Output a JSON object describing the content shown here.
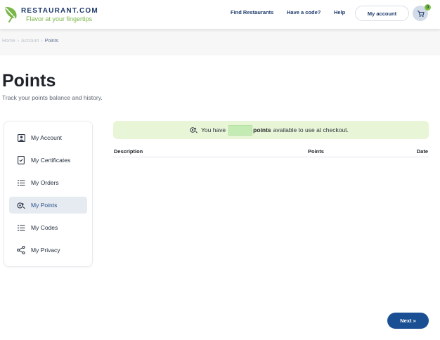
{
  "brand": {
    "name": "RESTAURANT.COM",
    "tagline": "Flavor at your fingertips",
    "colors": {
      "navy": "#1e3a6b",
      "green": "#7ab648"
    }
  },
  "nav": {
    "find_restaurants": "Find Restaurants",
    "have_a_code": "Have a code?",
    "help": "Help",
    "my_account": "My account",
    "cart_count": "0"
  },
  "breadcrumb": {
    "home": "Home",
    "sep1": "›",
    "account": "Account",
    "sep2": "›",
    "current": "Points"
  },
  "page": {
    "title": "Points",
    "subtitle": "Track your points balance and history."
  },
  "sidebar": {
    "items": [
      {
        "label": "My Account",
        "icon": "user-icon"
      },
      {
        "label": "My Certificates",
        "icon": "certificate-icon"
      },
      {
        "label": "My Orders",
        "icon": "list-icon"
      },
      {
        "label": "My Points",
        "icon": "points-icon",
        "active": true
      },
      {
        "label": "My Codes",
        "icon": "list-icon"
      },
      {
        "label": "My Privacy",
        "icon": "share-icon"
      }
    ]
  },
  "banner": {
    "prefix": "You have",
    "points_word": "points",
    "suffix": "available to use at checkout.",
    "points_value": ""
  },
  "table": {
    "columns": [
      "Description",
      "Points",
      "Date"
    ],
    "rows": []
  },
  "pagination": {
    "next_label": "Next »"
  }
}
